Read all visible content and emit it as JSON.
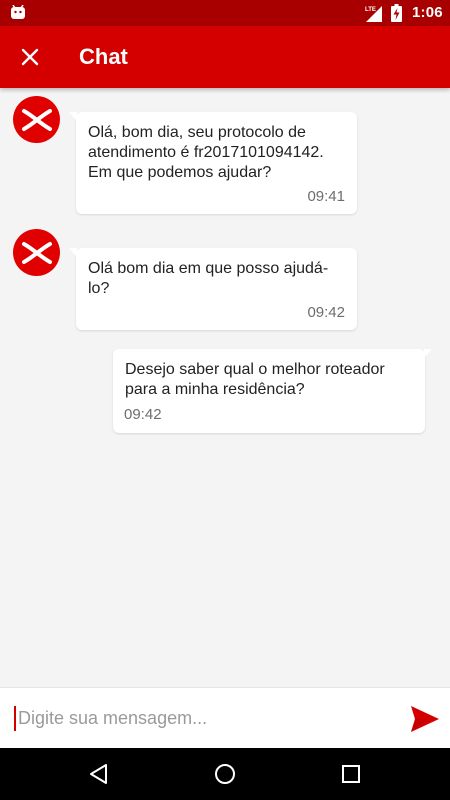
{
  "status_bar": {
    "network": "LTE",
    "time": "1:06"
  },
  "app_bar": {
    "title": "Chat",
    "close_icon": "close-icon"
  },
  "colors": {
    "brand_red": "#d40000",
    "status_bar": "#a80000",
    "background": "#f4f4f4"
  },
  "messages": [
    {
      "sender": "agent",
      "text": "Olá, bom dia, seu protocolo de\natendimento é fr2017101094142.\nEm que podemos ajudar?",
      "time": "09:41"
    },
    {
      "sender": "agent",
      "text": "Olá bom dia em que posso ajudá-lo?",
      "time": "09:42"
    },
    {
      "sender": "user",
      "text": "Desejo saber qual o melhor roteador\npara a minha residência?",
      "time": "09:42"
    }
  ],
  "composer": {
    "placeholder": "Digite sua mensagem...",
    "value": "",
    "send_icon": "send-icon"
  },
  "nav_bar": {
    "back_icon": "back-icon",
    "home_icon": "home-icon",
    "recents_icon": "recents-icon"
  }
}
